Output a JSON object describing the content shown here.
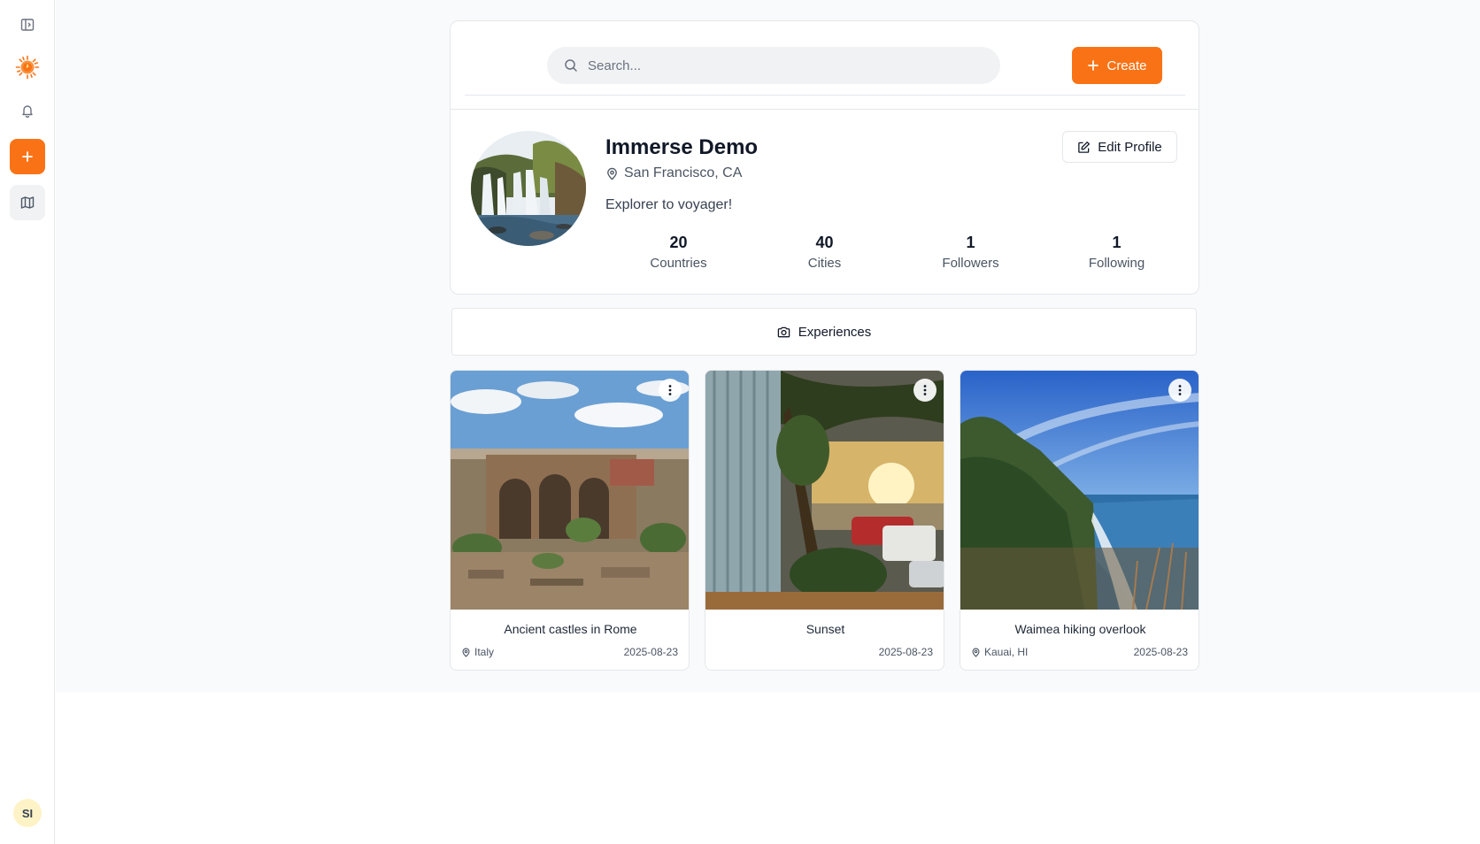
{
  "sidebar": {
    "items": [
      {
        "icon": "sidebar-toggle-icon"
      },
      {
        "icon": "sun-logo-icon"
      },
      {
        "icon": "bell-icon"
      },
      {
        "icon": "plus-icon"
      },
      {
        "icon": "map-icon"
      }
    ],
    "user_initials": "SI"
  },
  "header": {
    "search_placeholder": "Search...",
    "create_label": "Create"
  },
  "profile": {
    "name": "Immerse Demo",
    "location": "San Francisco, CA",
    "bio": "Explorer to voyager!",
    "edit_label": "Edit Profile",
    "stats": [
      {
        "value": "20",
        "label": "Countries"
      },
      {
        "value": "40",
        "label": "Cities"
      },
      {
        "value": "1",
        "label": "Followers"
      },
      {
        "value": "1",
        "label": "Following"
      }
    ]
  },
  "tabs": [
    {
      "label": "Experiences",
      "icon": "camera-icon",
      "active": true
    }
  ],
  "experiences": [
    {
      "title": "Ancient castles in Rome",
      "location": "Italy",
      "date": "2025-08-23",
      "image": "roman-ruins-photo"
    },
    {
      "title": "Sunset",
      "location": "",
      "date": "2025-08-23",
      "image": "sunset-parking-photo"
    },
    {
      "title": "Waimea hiking overlook",
      "location": "Kauai, HI",
      "date": "2025-08-23",
      "image": "coastal-cliffs-photo"
    }
  ],
  "colors": {
    "accent": "#f97316",
    "background": "#f9fafb",
    "border": "#e5e7eb",
    "avatar_bg": "#fef3c7"
  }
}
